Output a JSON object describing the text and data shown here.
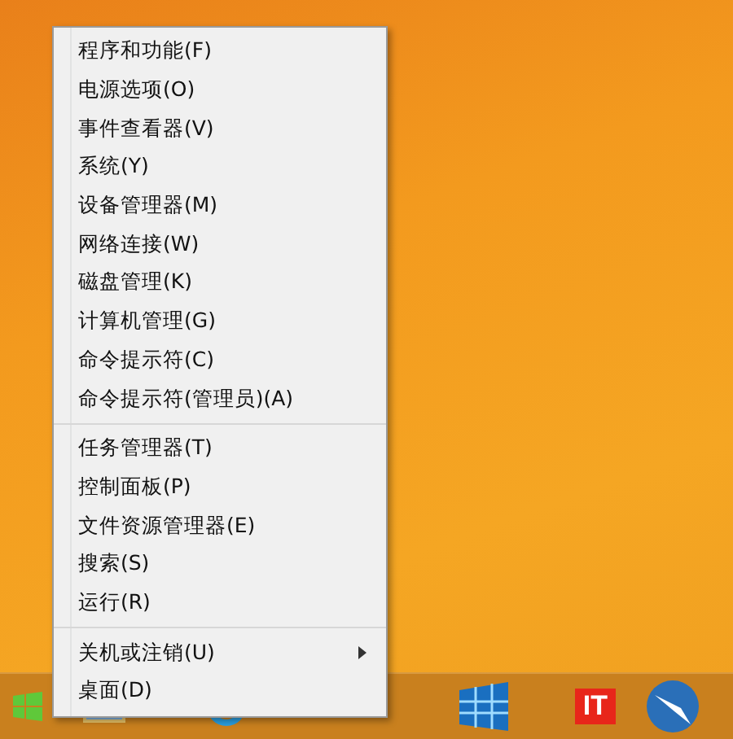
{
  "menu": {
    "sections": [
      {
        "items": [
          {
            "label": "程序和功能(F)",
            "submenu": false
          },
          {
            "label": "电源选项(O)",
            "submenu": false
          },
          {
            "label": "事件查看器(V)",
            "submenu": false
          },
          {
            "label": "系统(Y)",
            "submenu": false
          },
          {
            "label": "设备管理器(M)",
            "submenu": false
          },
          {
            "label": "网络连接(W)",
            "submenu": false
          },
          {
            "label": "磁盘管理(K)",
            "submenu": false
          },
          {
            "label": "计算机管理(G)",
            "submenu": false
          },
          {
            "label": "命令提示符(C)",
            "submenu": false
          },
          {
            "label": "命令提示符(管理员)(A)",
            "submenu": false
          }
        ]
      },
      {
        "items": [
          {
            "label": "任务管理器(T)",
            "submenu": false
          },
          {
            "label": "控制面板(P)",
            "submenu": false
          },
          {
            "label": "文件资源管理器(E)",
            "submenu": false
          },
          {
            "label": "搜索(S)",
            "submenu": false
          },
          {
            "label": "运行(R)",
            "submenu": false
          }
        ]
      },
      {
        "items": [
          {
            "label": "关机或注销(U)",
            "submenu": true
          },
          {
            "label": "桌面(D)",
            "submenu": false
          }
        ]
      }
    ]
  },
  "taskbar": {
    "icons": [
      {
        "kind": "start"
      },
      {
        "kind": "folder"
      },
      {
        "kind": "browser"
      },
      {
        "kind": "tiles"
      },
      {
        "kind": "logo",
        "text": "IT"
      },
      {
        "kind": "bird"
      }
    ]
  }
}
